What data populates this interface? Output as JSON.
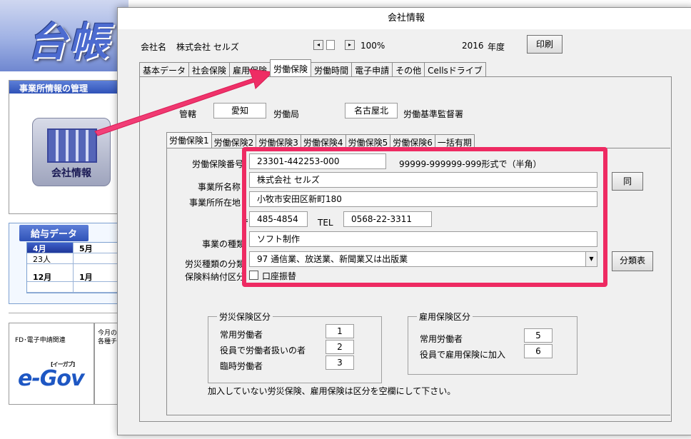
{
  "background": {
    "logo_text": "台帳",
    "office_panel_title": "事業所情報の管理",
    "company_icon_label": "会社情報",
    "salary_title": "給与データ",
    "salary_grid": [
      [
        "4月",
        "5月"
      ],
      [
        "23人",
        ""
      ],
      [
        "",
        ""
      ],
      [
        "12月",
        "1月"
      ],
      [
        "",
        ""
      ]
    ],
    "fd_label": "FD･電子申請関連",
    "egov_sub": "[イーガブ]",
    "egov_label": "e-Gov",
    "side_text": "今月の\n各種チ"
  },
  "dialog": {
    "title": "会社情報",
    "company_label": "会社名",
    "company_name": "株式会社 セルズ",
    "zoom": "100%",
    "year": "2016",
    "year_unit": "年度",
    "print_label": "印刷",
    "tabs": [
      "基本データ",
      "社会保険",
      "雇用保険",
      "労働保険",
      "労働時間",
      "電子申請",
      "その他",
      "Cellsドライブ"
    ],
    "active_tab": 3,
    "jurisdiction_label": "管轄",
    "prefecture": "愛知",
    "labor_bureau_label": "労働局",
    "office_city": "名古屋北",
    "labor_office_label": "労働基準監督署",
    "subtabs": [
      "労働保険1",
      "労働保険2",
      "労働保険3",
      "労働保険4",
      "労働保険5",
      "労働保険6",
      "一括有期"
    ],
    "active_subtab": 0,
    "fields": {
      "insurance_no_label": "労働保険番号",
      "insurance_no": "23301-442253-000",
      "insurance_no_hint": "99999-999999-999形式で（半角）",
      "office_name_label": "事業所名称",
      "office_name": "株式会社 セルズ",
      "same_button": "同",
      "office_address_label": "事業所所在地",
      "office_address": "小牧市安田区新町180",
      "postal_mark": "〒",
      "postal_code": "485-4854",
      "tel_label": "TEL",
      "tel": "0568-22-3311",
      "business_type_label": "事業の種類",
      "business_type": "ソフト制作",
      "classification_label": "労災種類の分類",
      "classification": "97 通信業、放送業、新聞業又は出版業",
      "classification_button": "分類表",
      "payment_label": "保険料納付区分",
      "payment_option": "口座振替"
    },
    "rousai_group": {
      "title": "労災保険区分",
      "rows": [
        {
          "label": "常用労働者",
          "value": "1"
        },
        {
          "label": "役員で労働者扱いの者",
          "value": "2"
        },
        {
          "label": "臨時労働者",
          "value": "3"
        }
      ]
    },
    "koyou_group": {
      "title": "雇用保険区分",
      "rows": [
        {
          "label": "常用労働者",
          "value": "5"
        },
        {
          "label": "役員で雇用保険に加入",
          "value": "6"
        }
      ]
    },
    "footer_note": "加入していない労災保険、雇用保険は区分を空欄にして下さい。"
  },
  "colors": {
    "highlight": "#ee2a62",
    "logo_blue": "#4c6bd0",
    "panel_blue": "#2f52b8"
  }
}
